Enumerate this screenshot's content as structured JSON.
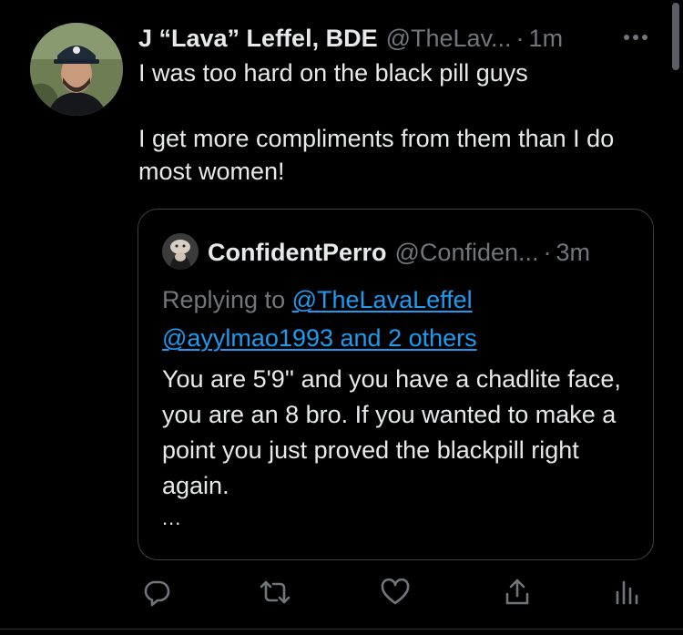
{
  "tweet": {
    "display_name": "J “Lava” Leffel, BDE",
    "handle": "@TheLav...",
    "separator": "·",
    "time": "1m",
    "body_line1": "I was too hard on the black pill guys",
    "body_line2": "I get more compliments from them than I do most women!"
  },
  "quote": {
    "display_name": "ConfidentPerro",
    "handle": "@Confiden...",
    "separator": "·",
    "time": "3m",
    "replying_prefix": "Replying to",
    "mention1": "@TheLavaLeffel",
    "mention2": "@ayylmao1993 and 2 others",
    "text": "You are 5'9'' and you have a chadlite face, you are an 8 bro. If you wanted to make a point you just proved the blackpill right again.",
    "truncation": "..."
  },
  "actions": [
    "reply-icon",
    "retweet-icon",
    "like-icon",
    "share-icon",
    "analytics-icon"
  ],
  "colors": {
    "background": "#000000",
    "text": "#e7e9ea",
    "secondary": "#71767b",
    "link": "#1d9bf0",
    "border": "#3e4144"
  }
}
